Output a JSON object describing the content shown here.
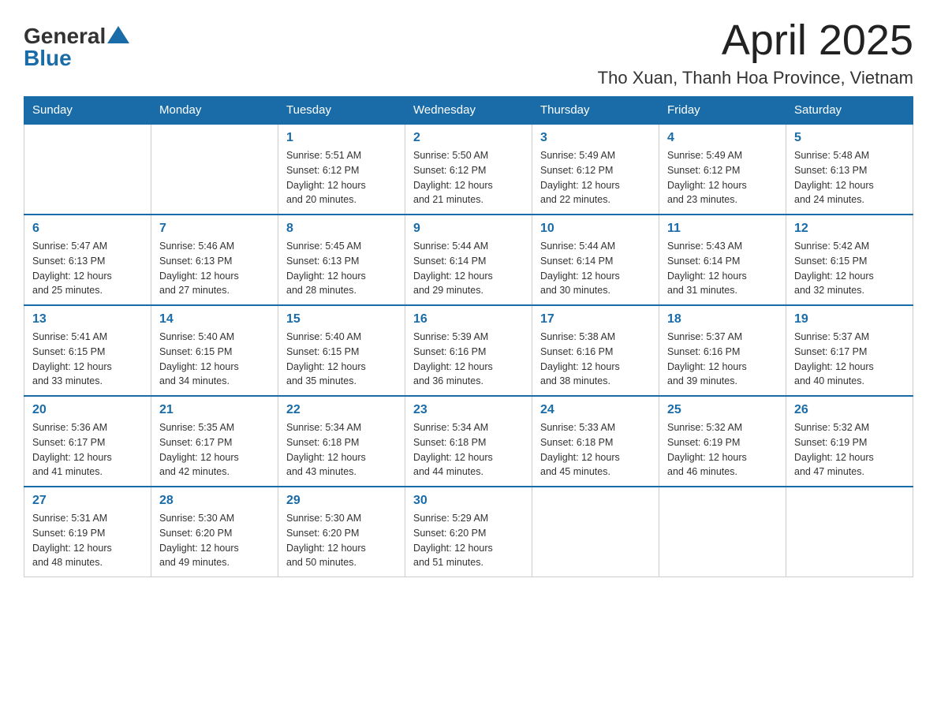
{
  "header": {
    "logo_general": "General",
    "logo_blue": "Blue",
    "month_title": "April 2025",
    "location": "Tho Xuan, Thanh Hoa Province, Vietnam"
  },
  "weekdays": [
    "Sunday",
    "Monday",
    "Tuesday",
    "Wednesday",
    "Thursday",
    "Friday",
    "Saturday"
  ],
  "weeks": [
    [
      {
        "day": "",
        "info": ""
      },
      {
        "day": "",
        "info": ""
      },
      {
        "day": "1",
        "info": "Sunrise: 5:51 AM\nSunset: 6:12 PM\nDaylight: 12 hours\nand 20 minutes."
      },
      {
        "day": "2",
        "info": "Sunrise: 5:50 AM\nSunset: 6:12 PM\nDaylight: 12 hours\nand 21 minutes."
      },
      {
        "day": "3",
        "info": "Sunrise: 5:49 AM\nSunset: 6:12 PM\nDaylight: 12 hours\nand 22 minutes."
      },
      {
        "day": "4",
        "info": "Sunrise: 5:49 AM\nSunset: 6:12 PM\nDaylight: 12 hours\nand 23 minutes."
      },
      {
        "day": "5",
        "info": "Sunrise: 5:48 AM\nSunset: 6:13 PM\nDaylight: 12 hours\nand 24 minutes."
      }
    ],
    [
      {
        "day": "6",
        "info": "Sunrise: 5:47 AM\nSunset: 6:13 PM\nDaylight: 12 hours\nand 25 minutes."
      },
      {
        "day": "7",
        "info": "Sunrise: 5:46 AM\nSunset: 6:13 PM\nDaylight: 12 hours\nand 27 minutes."
      },
      {
        "day": "8",
        "info": "Sunrise: 5:45 AM\nSunset: 6:13 PM\nDaylight: 12 hours\nand 28 minutes."
      },
      {
        "day": "9",
        "info": "Sunrise: 5:44 AM\nSunset: 6:14 PM\nDaylight: 12 hours\nand 29 minutes."
      },
      {
        "day": "10",
        "info": "Sunrise: 5:44 AM\nSunset: 6:14 PM\nDaylight: 12 hours\nand 30 minutes."
      },
      {
        "day": "11",
        "info": "Sunrise: 5:43 AM\nSunset: 6:14 PM\nDaylight: 12 hours\nand 31 minutes."
      },
      {
        "day": "12",
        "info": "Sunrise: 5:42 AM\nSunset: 6:15 PM\nDaylight: 12 hours\nand 32 minutes."
      }
    ],
    [
      {
        "day": "13",
        "info": "Sunrise: 5:41 AM\nSunset: 6:15 PM\nDaylight: 12 hours\nand 33 minutes."
      },
      {
        "day": "14",
        "info": "Sunrise: 5:40 AM\nSunset: 6:15 PM\nDaylight: 12 hours\nand 34 minutes."
      },
      {
        "day": "15",
        "info": "Sunrise: 5:40 AM\nSunset: 6:15 PM\nDaylight: 12 hours\nand 35 minutes."
      },
      {
        "day": "16",
        "info": "Sunrise: 5:39 AM\nSunset: 6:16 PM\nDaylight: 12 hours\nand 36 minutes."
      },
      {
        "day": "17",
        "info": "Sunrise: 5:38 AM\nSunset: 6:16 PM\nDaylight: 12 hours\nand 38 minutes."
      },
      {
        "day": "18",
        "info": "Sunrise: 5:37 AM\nSunset: 6:16 PM\nDaylight: 12 hours\nand 39 minutes."
      },
      {
        "day": "19",
        "info": "Sunrise: 5:37 AM\nSunset: 6:17 PM\nDaylight: 12 hours\nand 40 minutes."
      }
    ],
    [
      {
        "day": "20",
        "info": "Sunrise: 5:36 AM\nSunset: 6:17 PM\nDaylight: 12 hours\nand 41 minutes."
      },
      {
        "day": "21",
        "info": "Sunrise: 5:35 AM\nSunset: 6:17 PM\nDaylight: 12 hours\nand 42 minutes."
      },
      {
        "day": "22",
        "info": "Sunrise: 5:34 AM\nSunset: 6:18 PM\nDaylight: 12 hours\nand 43 minutes."
      },
      {
        "day": "23",
        "info": "Sunrise: 5:34 AM\nSunset: 6:18 PM\nDaylight: 12 hours\nand 44 minutes."
      },
      {
        "day": "24",
        "info": "Sunrise: 5:33 AM\nSunset: 6:18 PM\nDaylight: 12 hours\nand 45 minutes."
      },
      {
        "day": "25",
        "info": "Sunrise: 5:32 AM\nSunset: 6:19 PM\nDaylight: 12 hours\nand 46 minutes."
      },
      {
        "day": "26",
        "info": "Sunrise: 5:32 AM\nSunset: 6:19 PM\nDaylight: 12 hours\nand 47 minutes."
      }
    ],
    [
      {
        "day": "27",
        "info": "Sunrise: 5:31 AM\nSunset: 6:19 PM\nDaylight: 12 hours\nand 48 minutes."
      },
      {
        "day": "28",
        "info": "Sunrise: 5:30 AM\nSunset: 6:20 PM\nDaylight: 12 hours\nand 49 minutes."
      },
      {
        "day": "29",
        "info": "Sunrise: 5:30 AM\nSunset: 6:20 PM\nDaylight: 12 hours\nand 50 minutes."
      },
      {
        "day": "30",
        "info": "Sunrise: 5:29 AM\nSunset: 6:20 PM\nDaylight: 12 hours\nand 51 minutes."
      },
      {
        "day": "",
        "info": ""
      },
      {
        "day": "",
        "info": ""
      },
      {
        "day": "",
        "info": ""
      }
    ]
  ]
}
